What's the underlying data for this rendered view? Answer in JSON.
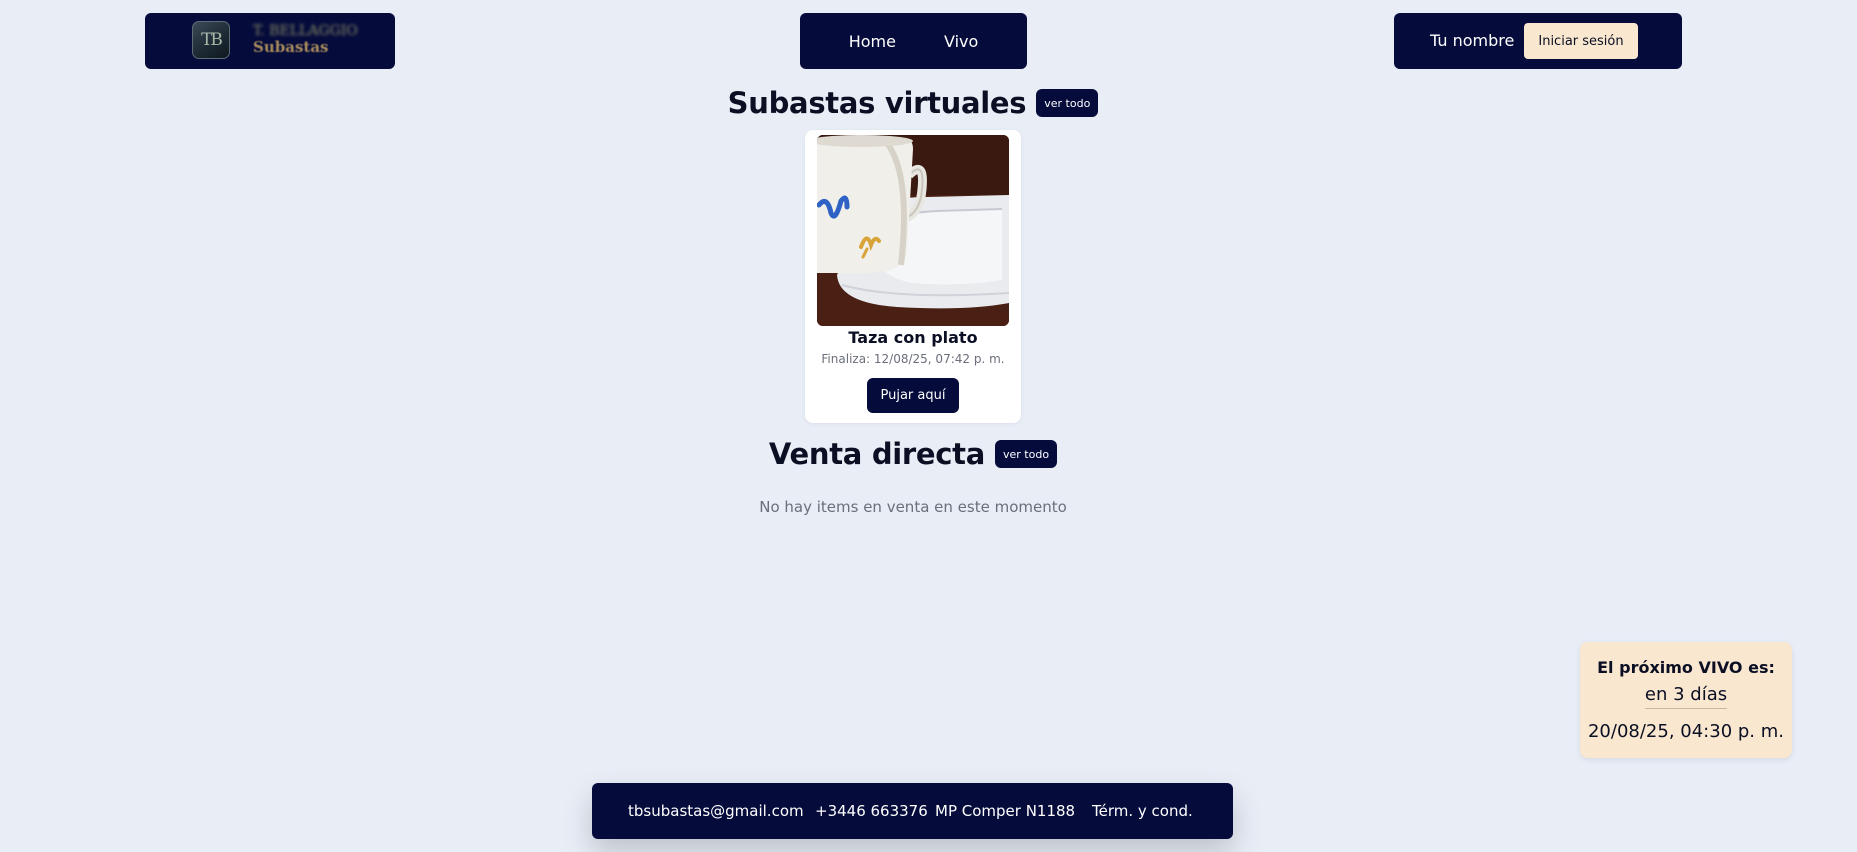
{
  "header": {
    "logo": {
      "line1": "T. BELLAGGIO",
      "line2": "Subastas",
      "mark": "TB"
    },
    "nav": {
      "home": "Home",
      "vivo": "Vivo"
    },
    "user": {
      "name": "Tu nombre",
      "login": "Iniciar sesión"
    }
  },
  "auctions": {
    "title": "Subastas virtuales",
    "see_all": "ver todo",
    "items": [
      {
        "title": "Taza con plato",
        "ends": "Finaliza: 12/08/25, 07:42 p. m.",
        "bid_label": "Pujar aquí"
      }
    ]
  },
  "direct_sale": {
    "title": "Venta directa",
    "see_all": "ver todo",
    "empty": "No hay items en venta en este momento"
  },
  "next_live": {
    "title": "El próximo VIVO es:",
    "relative": "en 3 días",
    "date": "20/08/25, 04:30 p. m."
  },
  "footer": {
    "email": "tbsubastas@gmail.com",
    "phone": "+3446 663376",
    "address": "MP Comper N1188",
    "terms": "Térm. y cond."
  },
  "colors": {
    "background": "#e8edf6",
    "navy": "#050b3b",
    "cream": "#f9e7cf"
  }
}
